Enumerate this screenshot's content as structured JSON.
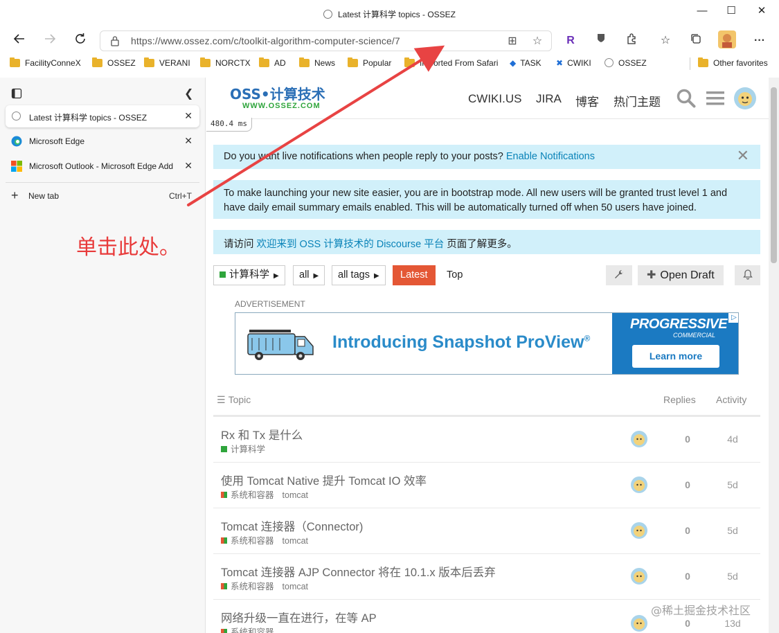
{
  "window": {
    "title": "Latest 计算科学 topics - OSSEZ",
    "minimize": "—",
    "maximize": "☐",
    "close": "✕"
  },
  "toolbar": {
    "url": "https://www.ossez.com/c/toolkit-algorithm-computer-science/7",
    "profile_letter": "R"
  },
  "favorites": [
    "FacilityConneX",
    "OSSEZ",
    "VERANI",
    "NORCTX",
    "AD",
    "News",
    "Popular",
    "Imported From Safari",
    "TASK",
    "CWIKI",
    "OSSEZ",
    "Other favorites"
  ],
  "sidebar": {
    "tabs": [
      {
        "label": "Latest 计算科学 topics - OSSEZ"
      },
      {
        "label": "Microsoft Edge"
      },
      {
        "label": "Microsoft Outlook - Microsoft Edge Add"
      }
    ],
    "new_tab": "New tab",
    "new_tab_shortcut": "Ctrl+T",
    "annotation": "单击此处。"
  },
  "site": {
    "logo": "OSS•计算技术",
    "logo_sub": "WWW.OSSEZ.COM",
    "nav": [
      "CWIKI.US",
      "JIRA",
      "博客",
      "热门主题"
    ],
    "timer": "480.4 ms"
  },
  "banners": {
    "notify_text": "Do you want live notifications when people reply to your posts?",
    "notify_link": "Enable Notifications",
    "bootstrap": "To make launching your new site easier, you are in bootstrap mode. All new users will be granted trust level 1 and have daily email summary emails enabled. This will be automatically turned off when 50 users have joined.",
    "visit_prefix": "请访问",
    "visit_link": "欢迎来到 OSS 计算技术的 Discourse 平台",
    "visit_suffix": "页面了解更多。"
  },
  "filters": {
    "category": "计算科学",
    "all": "all",
    "tags": "all tags",
    "latest": "Latest",
    "top": "Top",
    "open_draft": "Open Draft"
  },
  "ad": {
    "label": "ADVERTISEMENT",
    "headline": "Introducing Snapshot ProView",
    "brand": "PROGRESSIVE",
    "brand_sub": "COMMERCIAL",
    "cta": "Learn more"
  },
  "table": {
    "col_topic": "Topic",
    "col_replies": "Replies",
    "col_activity": "Activity",
    "rows": [
      {
        "title": "Rx 和 Tx 是什么",
        "category": "计算科学",
        "tag": "",
        "replies": "0",
        "activity": "4d"
      },
      {
        "title": "使用 Tomcat Native 提升 Tomcat IO 效率",
        "category": "系统和容器",
        "tag": "tomcat",
        "replies": "0",
        "activity": "5d"
      },
      {
        "title": "Tomcat 连接器（Connector)",
        "category": "系统和容器",
        "tag": "tomcat",
        "replies": "0",
        "activity": "5d"
      },
      {
        "title": "Tomcat 连接器 AJP Connector 将在 10.1.x 版本后丢弃",
        "category": "系统和容器",
        "tag": "tomcat",
        "replies": "0",
        "activity": "5d"
      },
      {
        "title": "网络升级一直在进行，在等 AP",
        "category": "系统和容器",
        "tag": "",
        "replies": "0",
        "activity": "13d"
      }
    ]
  },
  "watermark": "@稀土掘金技术社区"
}
